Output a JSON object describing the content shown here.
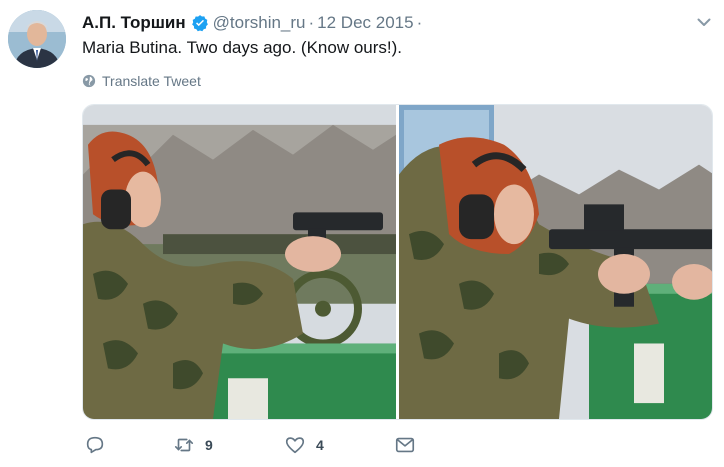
{
  "tweet": {
    "author_name": "А.П. Торшин",
    "handle": "@torshin_ru",
    "separator": "·",
    "date": "12 Dec 2015",
    "separator_end": "·",
    "text": "Maria Butina. Two days ago. (Know ours!).",
    "translate_label": "Translate Tweet",
    "verified": true
  },
  "icons": {
    "avatar": "avatar",
    "verified": "verified-badge-icon",
    "menu": "chevron-down-icon",
    "translate": "globe-icon",
    "reply": "reply-icon",
    "retweet": "retweet-icon",
    "like": "heart-icon",
    "message": "envelope-icon"
  },
  "actions": {
    "reply_count": "",
    "retweet_count": "9",
    "like_count": "4"
  },
  "colors": {
    "accent": "#1da1f2",
    "text": "#14171a",
    "secondary": "#657786"
  }
}
